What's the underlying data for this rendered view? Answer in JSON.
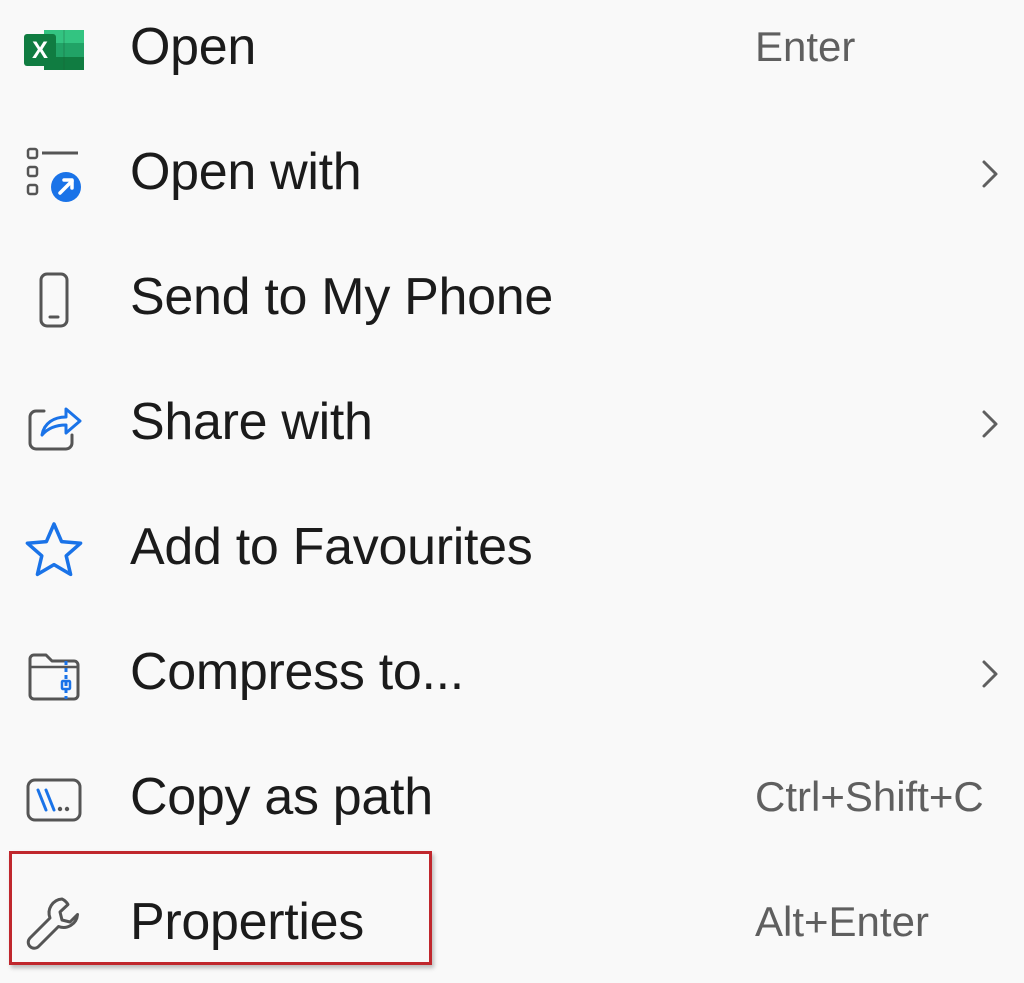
{
  "context_menu": {
    "items": [
      {
        "label": "Open",
        "shortcut": "Enter",
        "icon": "excel-icon"
      },
      {
        "label": "Open with",
        "shortcut": "",
        "icon": "open-with-icon",
        "submenu": true
      },
      {
        "label": "Send to My Phone",
        "shortcut": "",
        "icon": "phone-icon"
      },
      {
        "label": "Share with",
        "shortcut": "",
        "icon": "share-icon",
        "submenu": true
      },
      {
        "label": "Add to Favourites",
        "shortcut": "",
        "icon": "star-icon"
      },
      {
        "label": "Compress to...",
        "shortcut": "",
        "icon": "zip-folder-icon",
        "submenu": true
      },
      {
        "label": "Copy as path",
        "shortcut": "Ctrl+Shift+C",
        "icon": "copy-path-icon"
      },
      {
        "label": "Properties",
        "shortcut": "Alt+Enter",
        "icon": "wrench-icon",
        "highlighted": true
      }
    ],
    "colors": {
      "background": "#f9f9f9",
      "text": "#1b1b1b",
      "shortcut_text": "#5f5f5f",
      "accent_blue": "#1a73e8",
      "excel_green": "#1d6f42",
      "highlight_border": "#c0272d"
    }
  }
}
